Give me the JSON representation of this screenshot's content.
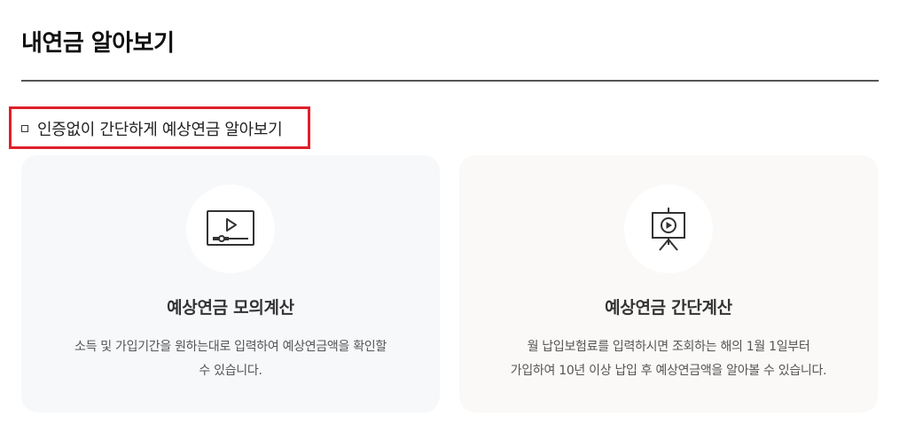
{
  "page": {
    "title": "내연금 알아보기"
  },
  "section": {
    "heading": "인증없이 간단하게 예상연금 알아보기"
  },
  "cards": [
    {
      "title": "예상연금 모의계산",
      "desc_line1": "소득 및 가입기간을 원하는대로 입력하여 예상연금액을 확인할",
      "desc_line2": "수 있습니다.",
      "icon": "video-player-icon"
    },
    {
      "title": "예상연금 간단계산",
      "desc_line1": "월 납입보험료를 입력하시면 조회하는 해의 1월 1일부터",
      "desc_line2": "가입하여 10년 이상 납입 후 예상연금액을 알아볼 수 있습니다.",
      "icon": "presentation-board-icon"
    }
  ],
  "colors": {
    "highlight_border": "#e0202a",
    "card_left_bg": "#f7f8fa",
    "card_right_bg": "#faf9f7"
  }
}
